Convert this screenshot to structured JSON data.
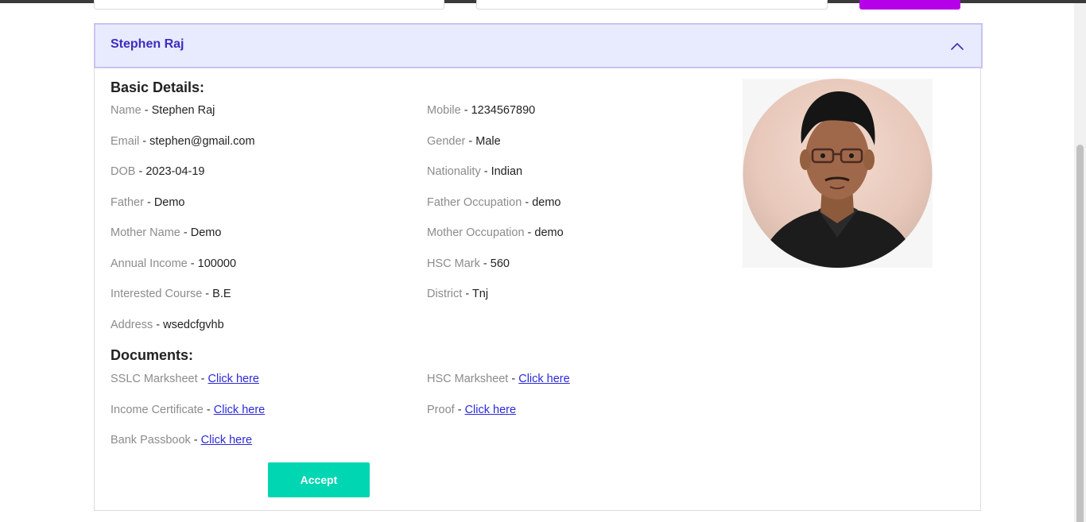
{
  "applicant": {
    "name": "Stephen Raj"
  },
  "basic": {
    "title": "Basic Details:",
    "left": [
      {
        "label": "Name",
        "value": "Stephen Raj"
      },
      {
        "label": "Email",
        "value": "stephen@gmail.com"
      },
      {
        "label": "DOB",
        "value": "2023-04-19"
      },
      {
        "label": "Father",
        "value": "Demo"
      },
      {
        "label": "Mother Name",
        "value": "Demo"
      },
      {
        "label": "Annual Income",
        "value": "100000"
      },
      {
        "label": "Interested Course",
        "value": "B.E"
      },
      {
        "label": "Address",
        "value": "wsedcfgvhb"
      }
    ],
    "right": [
      {
        "label": "Mobile",
        "value": "1234567890"
      },
      {
        "label": "Gender",
        "value": "Male"
      },
      {
        "label": "Nationality",
        "value": "Indian"
      },
      {
        "label": "Father Occupation",
        "value": "demo"
      },
      {
        "label": "Mother Occupation",
        "value": "demo"
      },
      {
        "label": "HSC Mark",
        "value": "560"
      },
      {
        "label": "District",
        "value": "Tnj"
      }
    ]
  },
  "documents": {
    "title": "Documents:",
    "items": [
      {
        "label": "SSLC Marksheet",
        "link": "Click here"
      },
      {
        "label": "HSC Marksheet",
        "link": "Click here"
      },
      {
        "label": "Income Certificate",
        "link": "Click here"
      },
      {
        "label": "Proof",
        "link": "Click here"
      },
      {
        "label": "Bank Passbook",
        "link": "Click here"
      }
    ]
  },
  "actions": {
    "accept_label": "Accept"
  },
  "colors": {
    "header_bg": "#e8ebfd",
    "header_text": "#3d2cc0",
    "accept_bg": "#00d6b2",
    "top_button": "#b500e8",
    "link": "#2c2ad6",
    "label": "#8c8c8c"
  },
  "icons": {
    "collapse": "chevron-up-icon",
    "photo": "applicant-photo"
  }
}
